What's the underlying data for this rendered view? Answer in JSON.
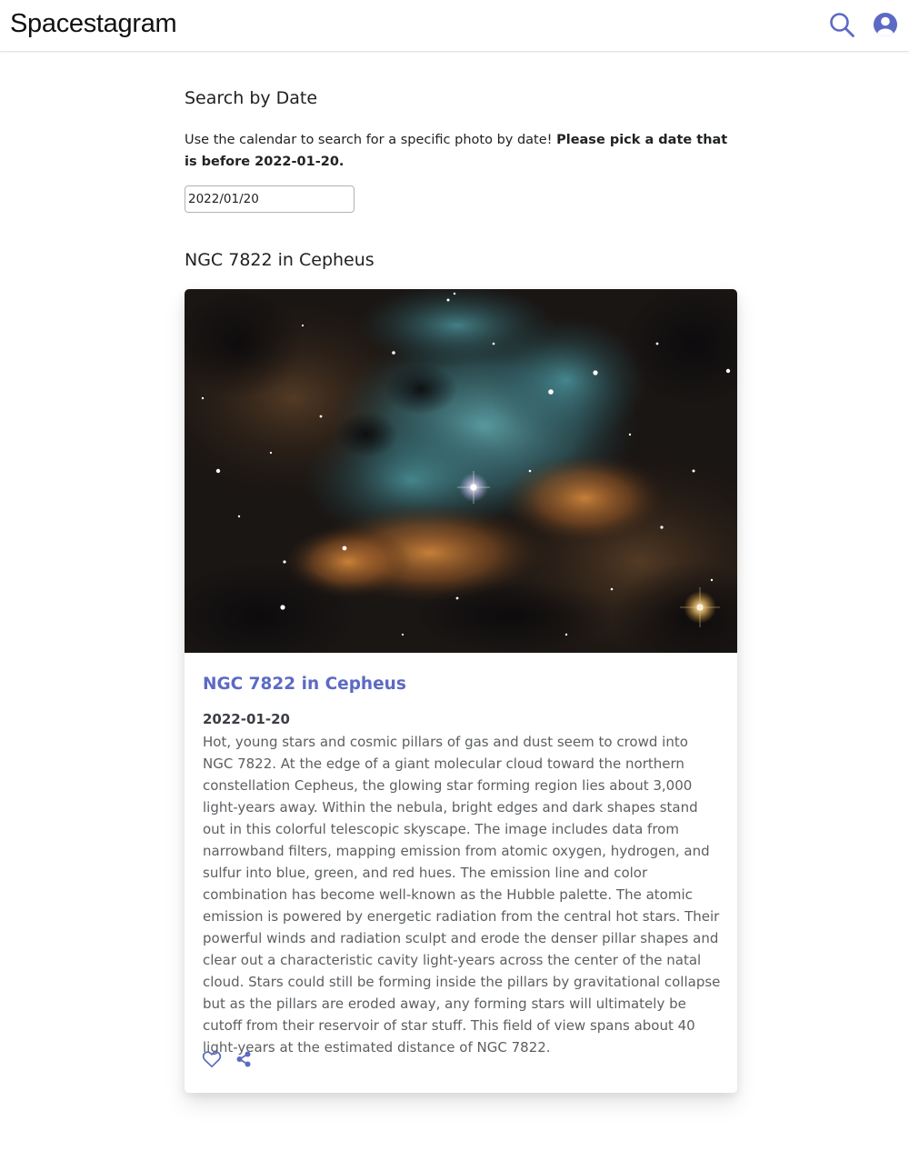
{
  "app": {
    "brand": "Spacestagram"
  },
  "header": {
    "search_icon": "search-icon",
    "account_icon": "user-circle-icon",
    "accent_color": "#5c6ac4"
  },
  "search": {
    "heading": "Search by Date",
    "intro_text": "Use the calendar to search for a specific photo by date! ",
    "intro_bold": "Please pick a date that is before 2022-01-20.",
    "date_value": "2022/01/20"
  },
  "result": {
    "heading": "NGC 7822 in Cepheus"
  },
  "card": {
    "image_alt": "NGC 7822 in Cepheus",
    "title": "NGC 7822 in Cepheus",
    "date": "2022-01-20",
    "description": "Hot, young stars and cosmic pillars of gas and dust seem to crowd into NGC 7822. At the edge of a giant molecular cloud toward the northern constellation Cepheus, the glowing star forming region lies about 3,000 light-years away. Within the nebula, bright edges and dark shapes stand out in this colorful telescopic skyscape. The image includes data from narrowband filters, mapping emission from atomic oxygen, hydrogen, and sulfur into blue, green, and red hues. The emission line and color combination has become well-known as the Hubble palette. The atomic emission is powered by energetic radiation from the central hot stars. Their powerful winds and radiation sculpt and erode the denser pillar shapes and clear out a characteristic cavity light-years across the center of the natal cloud. Stars could still be forming inside the pillars by gravitational collapse but as the pillars are eroded away, any forming stars will ultimately be cutoff from their reservoir of star stuff. This field of view spans about 40 light-years at the estimated distance of NGC 7822.",
    "like_icon": "heart-outline-icon",
    "share_icon": "share-icon"
  }
}
